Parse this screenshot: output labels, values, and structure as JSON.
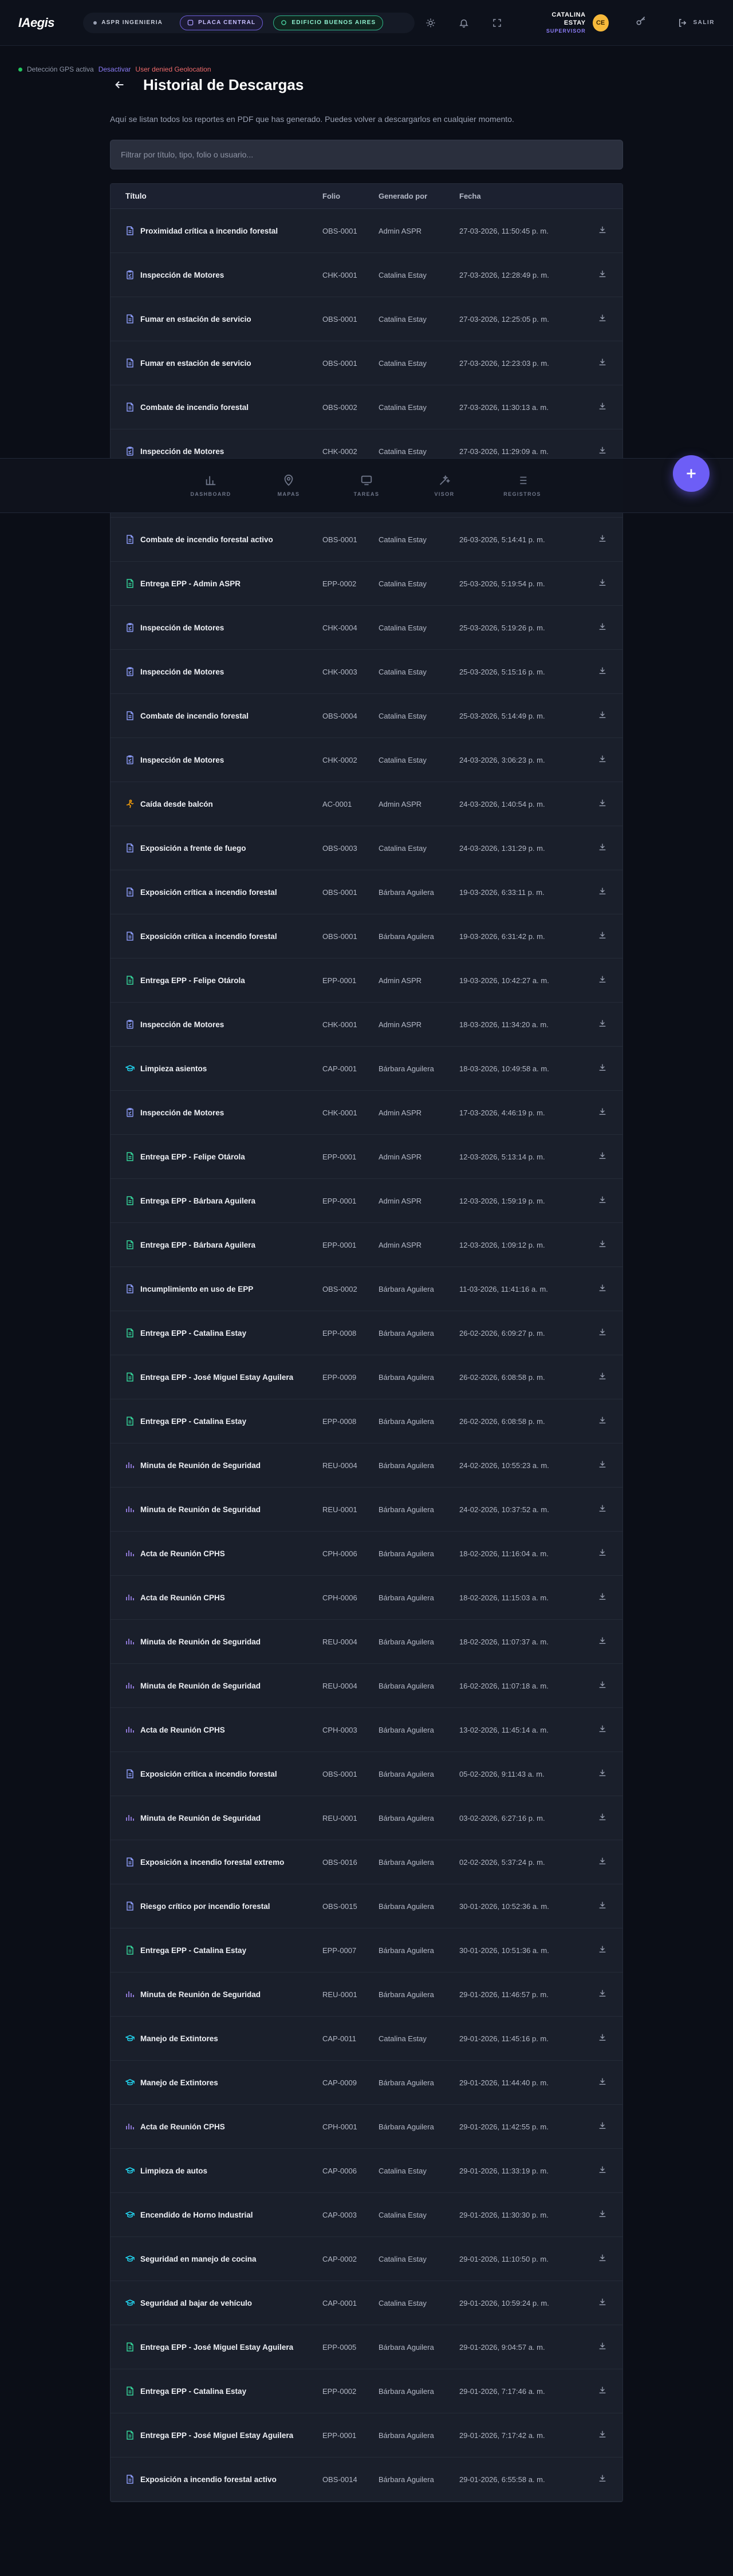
{
  "header": {
    "logo": "IAegis",
    "contexts": [
      {
        "label": "ASPR INGENIERIA",
        "style": "plain"
      },
      {
        "label": "PLACA CENTRAL",
        "style": "purple"
      },
      {
        "label": "EDIFICIO BUENOS AIRES",
        "style": "green"
      }
    ],
    "user": {
      "name": "CATALINA ESTAY",
      "role": "SUPERVISOR",
      "initials": "CE"
    },
    "logout_label": "SALIR"
  },
  "status": {
    "text": "Detección GPS activa",
    "deactivate": "Desactivar",
    "user_denied": "User denied Geolocation"
  },
  "page": {
    "title": "Historial de Descargas",
    "subtitle": "Aquí se listan todos los reportes en PDF que has generado. Puedes volver a descargarlos en cualquier momento.",
    "search_placeholder": "Filtrar por título, tipo, folio o usuario..."
  },
  "table": {
    "columns": [
      "Título",
      "Folio",
      "Generado por",
      "Fecha"
    ],
    "rows": [
      {
        "icon": "doc",
        "title": "Proximidad crítica a incendio forestal",
        "folio": "OBS-0001",
        "by": "Admin ASPR",
        "date": "27-03-2026, 11:50:45 p. m."
      },
      {
        "icon": "checklist",
        "title": "Inspección de Motores",
        "folio": "CHK-0001",
        "by": "Catalina Estay",
        "date": "27-03-2026, 12:28:49 p. m."
      },
      {
        "icon": "doc",
        "title": "Fumar en estación de servicio",
        "folio": "OBS-0001",
        "by": "Catalina Estay",
        "date": "27-03-2026, 12:25:05 p. m."
      },
      {
        "icon": "doc",
        "title": "Fumar en estación de servicio",
        "folio": "OBS-0001",
        "by": "Catalina Estay",
        "date": "27-03-2026, 12:23:03 p. m."
      },
      {
        "icon": "doc",
        "title": "Combate de incendio forestal",
        "folio": "OBS-0002",
        "by": "Catalina Estay",
        "date": "27-03-2026, 11:30:13 a. m."
      },
      {
        "icon": "checklist",
        "title": "Inspección de Motores",
        "folio": "CHK-0002",
        "by": "Catalina Estay",
        "date": "27-03-2026, 11:29:09 a. m."
      },
      {
        "icon": "doc",
        "title": "",
        "folio": "",
        "by": "",
        "date": ""
      },
      {
        "icon": "doc",
        "title": "Combate de incendio forestal activo",
        "folio": "OBS-0001",
        "by": "Catalina Estay",
        "date": "26-03-2026, 5:14:41 p. m."
      },
      {
        "icon": "epp",
        "title": "Entrega EPP - Admin ASPR",
        "folio": "EPP-0002",
        "by": "Catalina Estay",
        "date": "25-03-2026, 5:19:54 p. m."
      },
      {
        "icon": "checklist",
        "title": "Inspección de Motores",
        "folio": "CHK-0004",
        "by": "Catalina Estay",
        "date": "25-03-2026, 5:19:26 p. m."
      },
      {
        "icon": "checklist",
        "title": "Inspección de Motores",
        "folio": "CHK-0003",
        "by": "Catalina Estay",
        "date": "25-03-2026, 5:15:16 p. m."
      },
      {
        "icon": "doc",
        "title": "Combate de incendio forestal",
        "folio": "OBS-0004",
        "by": "Catalina Estay",
        "date": "25-03-2026, 5:14:49 p. m."
      },
      {
        "icon": "checklist",
        "title": "Inspección de Motores",
        "folio": "CHK-0002",
        "by": "Catalina Estay",
        "date": "24-03-2026, 3:06:23 p. m."
      },
      {
        "icon": "accident",
        "title": "Caída desde balcón",
        "folio": "AC-0001",
        "by": "Admin ASPR",
        "date": "24-03-2026, 1:40:54 p. m."
      },
      {
        "icon": "doc",
        "title": "Exposición a frente de fuego",
        "folio": "OBS-0003",
        "by": "Catalina Estay",
        "date": "24-03-2026, 1:31:29 p. m."
      },
      {
        "icon": "doc",
        "title": "Exposición crítica a incendio forestal",
        "folio": "OBS-0001",
        "by": "Bárbara Aguilera",
        "date": "19-03-2026, 6:33:11 p. m."
      },
      {
        "icon": "doc",
        "title": "Exposición crítica a incendio forestal",
        "folio": "OBS-0001",
        "by": "Bárbara Aguilera",
        "date": "19-03-2026, 6:31:42 p. m."
      },
      {
        "icon": "epp",
        "title": "Entrega EPP - Felipe Otárola",
        "folio": "EPP-0001",
        "by": "Admin ASPR",
        "date": "19-03-2026, 10:42:27 a. m."
      },
      {
        "icon": "checklist",
        "title": "Inspección de Motores",
        "folio": "CHK-0001",
        "by": "Admin ASPR",
        "date": "18-03-2026, 11:34:20 a. m."
      },
      {
        "icon": "cap",
        "title": "Limpieza asientos",
        "folio": "CAP-0001",
        "by": "Bárbara Aguilera",
        "date": "18-03-2026, 10:49:58 a. m."
      },
      {
        "icon": "checklist",
        "title": "Inspección de Motores",
        "folio": "CHK-0001",
        "by": "Admin ASPR",
        "date": "17-03-2026, 4:46:19 p. m."
      },
      {
        "icon": "epp",
        "title": "Entrega EPP - Felipe Otárola",
        "folio": "EPP-0001",
        "by": "Admin ASPR",
        "date": "12-03-2026, 5:13:14 p. m."
      },
      {
        "icon": "epp",
        "title": "Entrega EPP - Bárbara Aguilera",
        "folio": "EPP-0001",
        "by": "Admin ASPR",
        "date": "12-03-2026, 1:59:19 p. m."
      },
      {
        "icon": "epp",
        "title": "Entrega EPP - Bárbara Aguilera",
        "folio": "EPP-0001",
        "by": "Admin ASPR",
        "date": "12-03-2026, 1:09:12 p. m."
      },
      {
        "icon": "doc",
        "title": "Incumplimiento en uso de EPP",
        "folio": "OBS-0002",
        "by": "Bárbara Aguilera",
        "date": "11-03-2026, 11:41:16 a. m."
      },
      {
        "icon": "epp",
        "title": "Entrega EPP - Catalina Estay",
        "folio": "EPP-0008",
        "by": "Bárbara Aguilera",
        "date": "26-02-2026, 6:09:27 p. m."
      },
      {
        "icon": "epp",
        "title": "Entrega EPP - José Miguel Estay Aguilera",
        "folio": "EPP-0009",
        "by": "Bárbara Aguilera",
        "date": "26-02-2026, 6:08:58 p. m."
      },
      {
        "icon": "epp",
        "title": "Entrega EPP - Catalina Estay",
        "folio": "EPP-0008",
        "by": "Bárbara Aguilera",
        "date": "26-02-2026, 6:08:58 p. m."
      },
      {
        "icon": "meeting",
        "title": "Minuta de Reunión de Seguridad",
        "folio": "REU-0004",
        "by": "Bárbara Aguilera",
        "date": "24-02-2026, 10:55:23 a. m."
      },
      {
        "icon": "meeting",
        "title": "Minuta de Reunión de Seguridad",
        "folio": "REU-0001",
        "by": "Bárbara Aguilera",
        "date": "24-02-2026, 10:37:52 a. m."
      },
      {
        "icon": "meeting",
        "title": "Acta de Reunión CPHS",
        "folio": "CPH-0006",
        "by": "Bárbara Aguilera",
        "date": "18-02-2026, 11:16:04 a. m."
      },
      {
        "icon": "meeting",
        "title": "Acta de Reunión CPHS",
        "folio": "CPH-0006",
        "by": "Bárbara Aguilera",
        "date": "18-02-2026, 11:15:03 a. m."
      },
      {
        "icon": "meeting",
        "title": "Minuta de Reunión de Seguridad",
        "folio": "REU-0004",
        "by": "Bárbara Aguilera",
        "date": "18-02-2026, 11:07:37 a. m."
      },
      {
        "icon": "meeting",
        "title": "Minuta de Reunión de Seguridad",
        "folio": "REU-0004",
        "by": "Bárbara Aguilera",
        "date": "16-02-2026, 11:07:18 a. m."
      },
      {
        "icon": "meeting",
        "title": "Acta de Reunión CPHS",
        "folio": "CPH-0003",
        "by": "Bárbara Aguilera",
        "date": "13-02-2026, 11:45:14 a. m."
      },
      {
        "icon": "doc",
        "title": "Exposición crítica a incendio forestal",
        "folio": "OBS-0001",
        "by": "Bárbara Aguilera",
        "date": "05-02-2026, 9:11:43 a. m."
      },
      {
        "icon": "meeting",
        "title": "Minuta de Reunión de Seguridad",
        "folio": "REU-0001",
        "by": "Bárbara Aguilera",
        "date": "03-02-2026, 6:27:16 p. m."
      },
      {
        "icon": "doc",
        "title": "Exposición a incendio forestal extremo",
        "folio": "OBS-0016",
        "by": "Bárbara Aguilera",
        "date": "02-02-2026, 5:37:24 p. m."
      },
      {
        "icon": "doc",
        "title": "Riesgo crítico por incendio forestal",
        "folio": "OBS-0015",
        "by": "Bárbara Aguilera",
        "date": "30-01-2026, 10:52:36 a. m."
      },
      {
        "icon": "epp",
        "title": "Entrega EPP - Catalina Estay",
        "folio": "EPP-0007",
        "by": "Bárbara Aguilera",
        "date": "30-01-2026, 10:51:36 a. m."
      },
      {
        "icon": "meeting",
        "title": "Minuta de Reunión de Seguridad",
        "folio": "REU-0001",
        "by": "Bárbara Aguilera",
        "date": "29-01-2026, 11:46:57 p. m."
      },
      {
        "icon": "cap",
        "title": "Manejo de Extintores",
        "folio": "CAP-0011",
        "by": "Catalina Estay",
        "date": "29-01-2026, 11:45:16 p. m."
      },
      {
        "icon": "cap",
        "title": "Manejo de Extintores",
        "folio": "CAP-0009",
        "by": "Bárbara Aguilera",
        "date": "29-01-2026, 11:44:40 p. m."
      },
      {
        "icon": "meeting",
        "title": "Acta de Reunión CPHS",
        "folio": "CPH-0001",
        "by": "Bárbara Aguilera",
        "date": "29-01-2026, 11:42:55 p. m."
      },
      {
        "icon": "cap",
        "title": "Limpieza de autos",
        "folio": "CAP-0006",
        "by": "Catalina Estay",
        "date": "29-01-2026, 11:33:19 p. m."
      },
      {
        "icon": "cap",
        "title": "Encendido de Horno Industrial",
        "folio": "CAP-0003",
        "by": "Catalina Estay",
        "date": "29-01-2026, 11:30:30 p. m."
      },
      {
        "icon": "cap",
        "title": "Seguridad en manejo de cocina",
        "folio": "CAP-0002",
        "by": "Catalina Estay",
        "date": "29-01-2026, 11:10:50 p. m."
      },
      {
        "icon": "cap",
        "title": "Seguridad al bajar de vehículo",
        "folio": "CAP-0001",
        "by": "Catalina Estay",
        "date": "29-01-2026, 10:59:24 p. m."
      },
      {
        "icon": "epp",
        "title": "Entrega EPP - José Miguel Estay Aguilera",
        "folio": "EPP-0005",
        "by": "Bárbara Aguilera",
        "date": "29-01-2026, 9:04:57 a. m."
      },
      {
        "icon": "epp",
        "title": "Entrega EPP - Catalina Estay",
        "folio": "EPP-0002",
        "by": "Bárbara Aguilera",
        "date": "29-01-2026, 7:17:46 a. m."
      },
      {
        "icon": "epp",
        "title": "Entrega EPP - José Miguel Estay Aguilera",
        "folio": "EPP-0001",
        "by": "Bárbara Aguilera",
        "date": "29-01-2026, 7:17:42 a. m."
      },
      {
        "icon": "doc",
        "title": "Exposición a incendio forestal activo",
        "folio": "OBS-0014",
        "by": "Bárbara Aguilera",
        "date": "29-01-2026, 6:55:58 a. m."
      }
    ]
  },
  "bottom_nav": [
    {
      "label": "DASHBOARD",
      "icon": "chart-icon"
    },
    {
      "label": "MAPAS",
      "icon": "map-pin-icon"
    },
    {
      "label": "TAREAS",
      "icon": "monitor-icon"
    },
    {
      "label": "VISOR",
      "icon": "magic-icon"
    },
    {
      "label": "REGISTROS",
      "icon": "list-icon"
    }
  ],
  "colors": {
    "accent": "#6d5ef6",
    "doc_icon": "#8b9cf8",
    "epp_icon": "#34d399",
    "cap_icon": "#22d3ee",
    "accident_icon": "#f59e0b",
    "meeting_icon": "#a78bfa"
  }
}
